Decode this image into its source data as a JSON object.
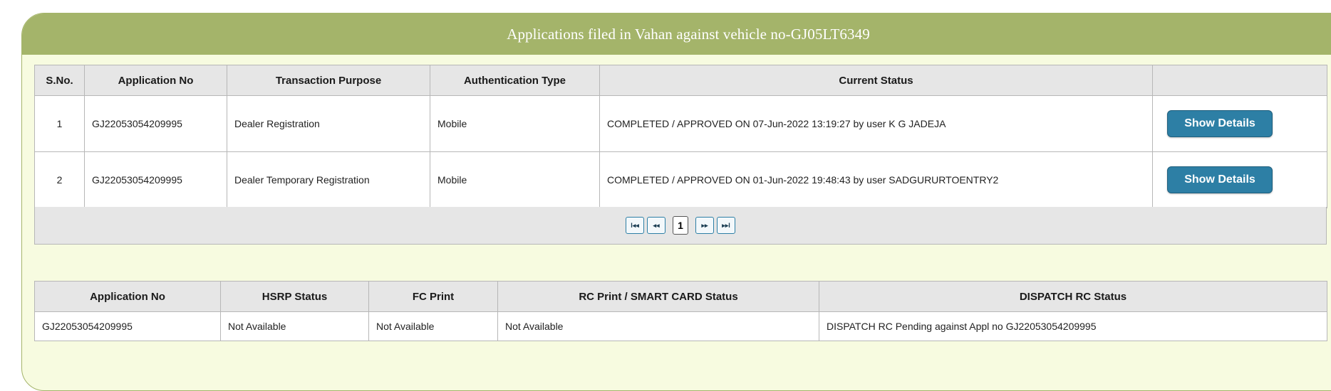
{
  "panel": {
    "title": "Applications filed in Vahan against vehicle no-GJ05LT6349"
  },
  "apps_table": {
    "headers": [
      "S.No.",
      "Application No",
      "Transaction Purpose",
      "Authentication Type",
      "Current Status",
      ""
    ],
    "rows": [
      {
        "sno": "1",
        "app_no": "GJ22053054209995",
        "purpose": "Dealer Registration",
        "auth": "Mobile",
        "status": "COMPLETED / APPROVED ON 07-Jun-2022 13:19:27 by user K G JADEJA",
        "action": "Show Details"
      },
      {
        "sno": "2",
        "app_no": "GJ22053054209995",
        "purpose": "Dealer Temporary Registration",
        "auth": "Mobile",
        "status": "COMPLETED / APPROVED ON 01-Jun-2022 19:48:43 by user SADGURURTOENTRY2",
        "action": "Show Details"
      }
    ]
  },
  "pager": {
    "first": "I◂◂",
    "prev": "◂◂",
    "page": "1",
    "next": "▸▸",
    "last": "▸▸I"
  },
  "status_table": {
    "headers": [
      "Application No",
      "HSRP Status",
      "FC Print",
      "RC Print / SMART CARD Status",
      "DISPATCH RC Status"
    ],
    "row": {
      "app_no": "GJ22053054209995",
      "hsrp": "Not Available",
      "fc": "Not Available",
      "rc": "Not Available",
      "dispatch": "DISPATCH RC Pending against Appl no GJ22053054209995"
    }
  },
  "colors": {
    "header_green": "#a4b46a",
    "panel_bg": "#f7fbe0",
    "button_blue": "#2d7fa5"
  }
}
